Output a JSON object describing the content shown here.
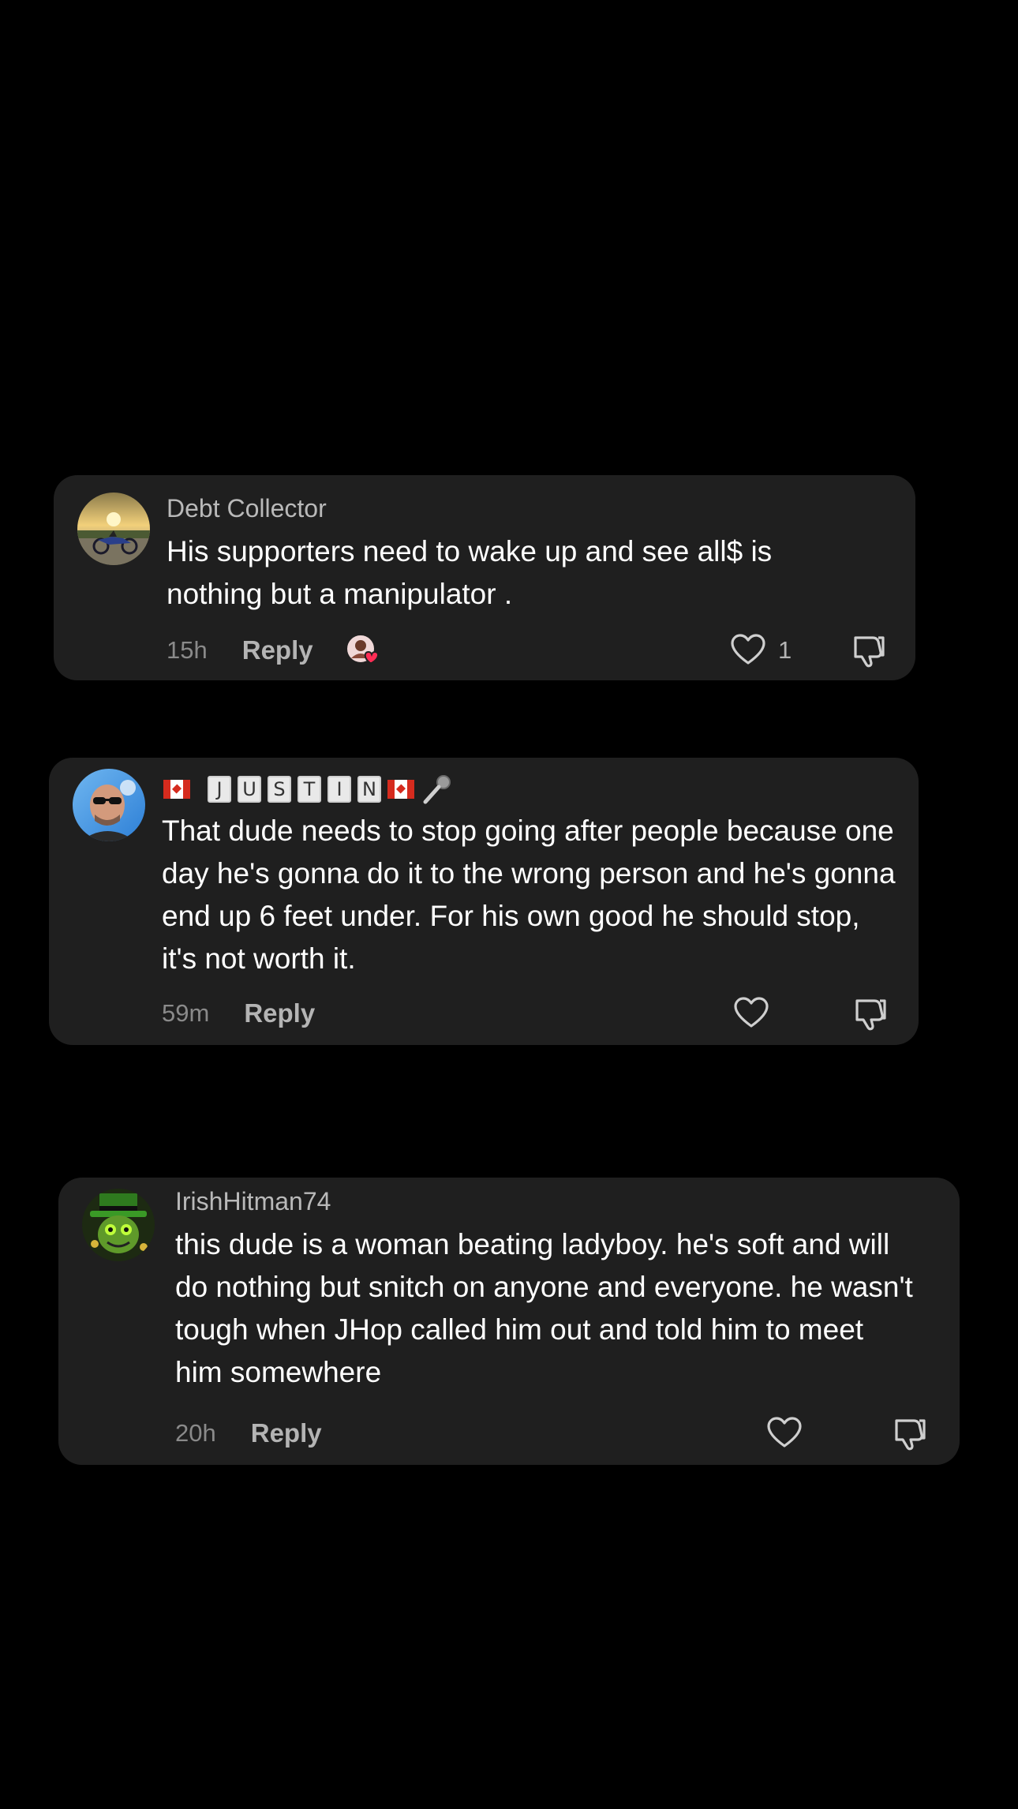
{
  "comments": [
    {
      "username": "Debt Collector",
      "text": "His supporters need to wake up and see all$ is nothing but a manipulator .",
      "time": "15h",
      "reply_label": "Reply",
      "like_count": "1",
      "avatar_icon": "sunset-motorcycle-avatar",
      "creator_liked": true
    },
    {
      "username_letters": [
        "J",
        "U",
        "S",
        "T",
        "I",
        "N"
      ],
      "text": "That dude needs to stop going after people because one day he's gonna do it to the wrong person and he's gonna end up 6 feet under. For his own good he should stop, it's not worth it.",
      "time": "59m",
      "reply_label": "Reply",
      "avatar_icon": "man-sunglasses-avatar"
    },
    {
      "username": "IrishHitman74",
      "text": "this dude is a woman beating ladyboy. he's soft and will do nothing but snitch on anyone and everyone. he wasn't tough when JHop called him out and told him to meet him somewhere",
      "time": "20h",
      "reply_label": "Reply",
      "avatar_icon": "green-leprechaun-avatar"
    }
  ],
  "colors": {
    "background": "#000000",
    "card": "#1f1f1f",
    "text": "#ffffff",
    "username": "#b9b9b9",
    "muted": "#8a8a8a"
  }
}
